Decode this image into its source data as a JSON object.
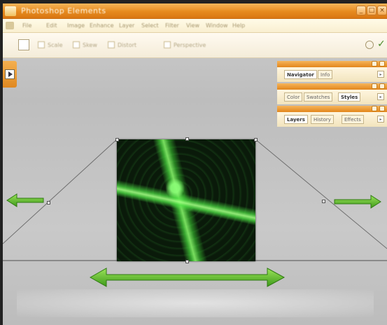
{
  "window": {
    "title": "Photoshop Elements",
    "controls": [
      "_",
      "□",
      "×"
    ]
  },
  "menu": {
    "items": [
      "File",
      "Edit",
      "Image",
      "Enhance",
      "Layer",
      "Select",
      "Filter",
      "View",
      "Window",
      "Help"
    ]
  },
  "toolbar": {
    "groups": [
      "Scale",
      "Skew",
      "Distort",
      "Perspective"
    ],
    "commit_icon": "checkmark-icon",
    "cancel_icon": "cancel-icon"
  },
  "palettes": [
    {
      "tabs": [
        "Navigator",
        "Info"
      ],
      "active": 0
    },
    {
      "tabs": [
        "Color",
        "Swatches",
        "Styles"
      ],
      "active": 2
    },
    {
      "tabs": [
        "Layers",
        "History",
        "Effects"
      ],
      "active": 0
    }
  ],
  "colors": {
    "accent_orange": "#e68a1e",
    "arrow_green": "#5fbf2a",
    "canvas_gray": "#c4c4c4"
  },
  "icons": {
    "left_tab": "play-arrow-icon",
    "arrows": [
      "left-arrow-icon",
      "right-arrow-icon",
      "double-arrow-icon"
    ]
  }
}
